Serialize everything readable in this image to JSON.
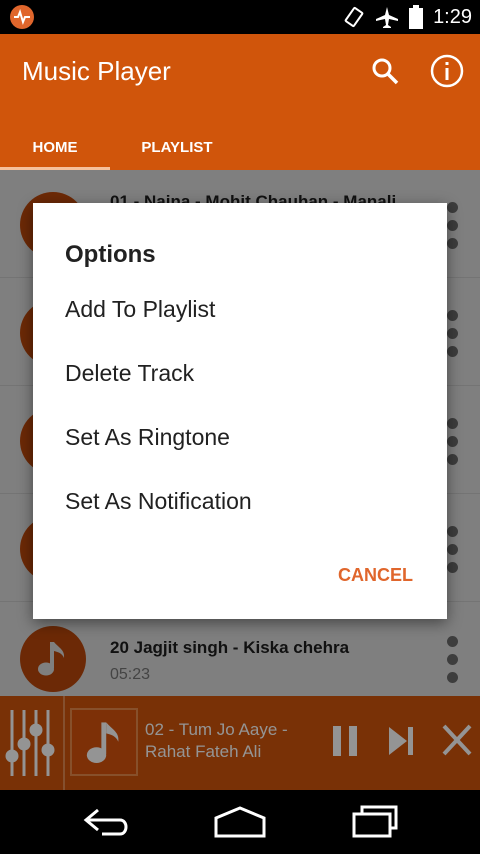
{
  "status_bar": {
    "time": "1:29",
    "icons": [
      "app-notification-icon",
      "screen-rotation-icon",
      "airplane-mode-icon",
      "battery-icon"
    ]
  },
  "header": {
    "title": "Music Player",
    "search_icon": "search-icon",
    "info_icon": "info-icon",
    "tabs": [
      {
        "label": "HOME",
        "active": true
      },
      {
        "label": "PLAYLIST",
        "active": false
      }
    ]
  },
  "tracks": [
    {
      "title": "01 - Naina - Mohit Chauhan - Manali",
      "duration": ""
    },
    {
      "title": "",
      "duration": ""
    },
    {
      "title": "",
      "duration": ""
    },
    {
      "title": "",
      "duration": ""
    },
    {
      "title": "20 Jagjit singh - Kiska chehra",
      "duration": "05:23"
    }
  ],
  "dialog": {
    "title": "Options",
    "options": [
      "Add To Playlist",
      "Delete Track",
      "Set As Ringtone",
      "Set As Notification"
    ],
    "cancel_label": "CANCEL"
  },
  "mini_player": {
    "title": "02 - Tum Jo Aaye -",
    "artist": "Rahat Fateh Ali",
    "icons": [
      "equalizer-icon",
      "pause-icon",
      "skip-next-icon",
      "close-icon"
    ]
  },
  "nav_bar": {
    "icons": [
      "back-icon",
      "home-icon",
      "recents-icon"
    ]
  },
  "colors": {
    "primary": "#d0550b",
    "accent": "#e0662c",
    "tab_indicator": "#f6c09c"
  }
}
